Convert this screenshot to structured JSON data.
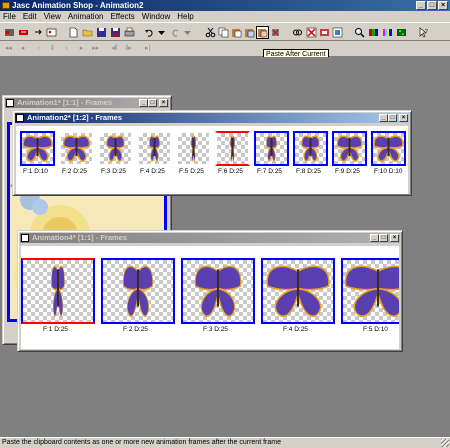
{
  "app": {
    "title": "Jasc Animation Shop - Animation2",
    "title_buttons": [
      "_",
      "□",
      "×"
    ]
  },
  "menu": [
    "File",
    "Edit",
    "View",
    "Animation",
    "Effects",
    "Window",
    "Help"
  ],
  "tooltip": "Paste After Current",
  "status": "Paste the clipboard contents as one or more new animation frames after the current frame",
  "windows": {
    "anim1": {
      "title": "Animation1* [1:1] - Frames"
    },
    "anim2": {
      "title": "Animation2* [1:2] - Frames",
      "frames": [
        {
          "label": "F:1  D:10",
          "selected": true,
          "current": false
        },
        {
          "label": "F:2  D:25",
          "selected": false,
          "current": false
        },
        {
          "label": "F:3  D:25",
          "selected": false,
          "current": false
        },
        {
          "label": "F:4  D:25",
          "selected": false,
          "current": false
        },
        {
          "label": "F:5  D:25",
          "selected": false,
          "current": false
        },
        {
          "label": "F:6  D:25",
          "selected": false,
          "current": true
        },
        {
          "label": "F:7  D:25",
          "selected": true,
          "current": false
        },
        {
          "label": "F:8  D:25",
          "selected": true,
          "current": false
        },
        {
          "label": "F:9  D:25",
          "selected": true,
          "current": false
        },
        {
          "label": "F:10  D:10",
          "selected": true,
          "current": false
        }
      ]
    },
    "anim4": {
      "title": "Animation4* [1:1] - Frames",
      "frames": [
        {
          "label": "F:1  D:25",
          "selected": true,
          "current": true
        },
        {
          "label": "F:2  D:25",
          "selected": true,
          "current": false
        },
        {
          "label": "F:3  D:25",
          "selected": true,
          "current": false
        },
        {
          "label": "F:4  D:25",
          "selected": true,
          "current": false
        },
        {
          "label": "F:5  D:10",
          "selected": true,
          "current": false
        }
      ]
    }
  },
  "colors": {
    "active_title": "#0a246a",
    "selection": "#0000ff",
    "current": "#ff0000",
    "butterfly_wing": "#5a3fb0",
    "butterfly_edge": "#e8a020"
  }
}
